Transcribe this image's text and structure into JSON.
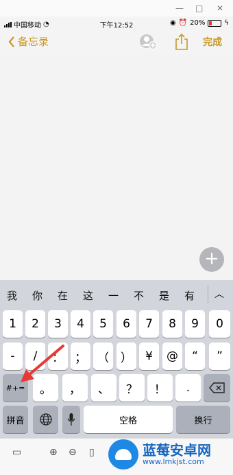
{
  "status": {
    "carrier": "中国移动",
    "time": "下午12:52",
    "battery": "20%"
  },
  "nav": {
    "back_label": "备忘录",
    "done_label": "完成"
  },
  "keyboard": {
    "candidates": [
      "我",
      "你",
      "在",
      "这",
      "一",
      "不",
      "是",
      "有"
    ],
    "row1": [
      "1",
      "2",
      "3",
      "4",
      "5",
      "6",
      "7",
      "8",
      "9",
      "0"
    ],
    "row2": [
      "-",
      "/",
      "：",
      "；",
      "（",
      "）",
      "¥",
      "@",
      "“",
      "”"
    ],
    "row3_mode": "#+=",
    "row3": [
      "。",
      "，",
      "、",
      "？",
      "！",
      "."
    ],
    "row4": {
      "pinyin": "拼音",
      "space": "空格",
      "return": "换行"
    }
  },
  "watermark": {
    "title": "蓝莓安卓网",
    "url": "www.lmkjst.com"
  }
}
